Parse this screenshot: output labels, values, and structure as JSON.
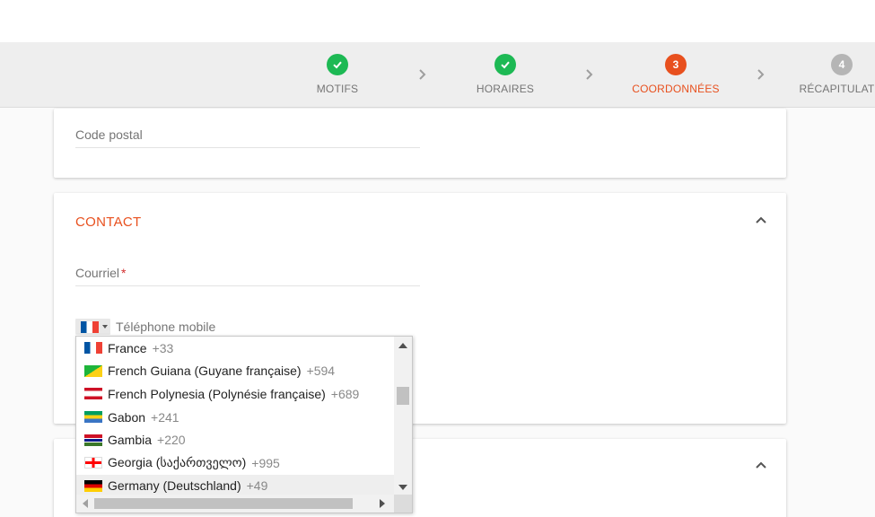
{
  "stepper": {
    "steps": [
      {
        "label": "MOTIFS",
        "status": "done",
        "icon": "check-icon"
      },
      {
        "label": "HORAIRES",
        "status": "done",
        "icon": "check-icon"
      },
      {
        "label": "COORDONNÉES",
        "status": "current",
        "number": "3"
      },
      {
        "label": "RÉCAPITULATIF",
        "status": "todo",
        "number": "4"
      }
    ]
  },
  "address_card": {
    "postal_code_placeholder": "Code postal"
  },
  "contact_card": {
    "title": "CONTACT",
    "email_label": "Courriel",
    "required_mark": "*",
    "phone_placeholder": "Téléphone mobile",
    "selected_country_flag": "flag-france-icon"
  },
  "country_dropdown": {
    "items": [
      {
        "name": "France",
        "dial": "+33",
        "flag": "flag-fr"
      },
      {
        "name": "French Guiana (Guyane française)",
        "dial": "+594",
        "flag": "flag-gf"
      },
      {
        "name": "French Polynesia (Polynésie française)",
        "dial": "+689",
        "flag": "flag-pf"
      },
      {
        "name": "Gabon",
        "dial": "+241",
        "flag": "flag-ga"
      },
      {
        "name": "Gambia",
        "dial": "+220",
        "flag": "flag-gm"
      },
      {
        "name": "Georgia (საქართველო)",
        "dial": "+995",
        "flag": "flag-ge"
      },
      {
        "name": "Germany (Deutschland)",
        "dial": "+49",
        "flag": "flag-de",
        "highlighted": true
      }
    ]
  },
  "colors": {
    "accent": "#e8501e",
    "done": "#1db954",
    "todo": "#b5b5b5"
  }
}
